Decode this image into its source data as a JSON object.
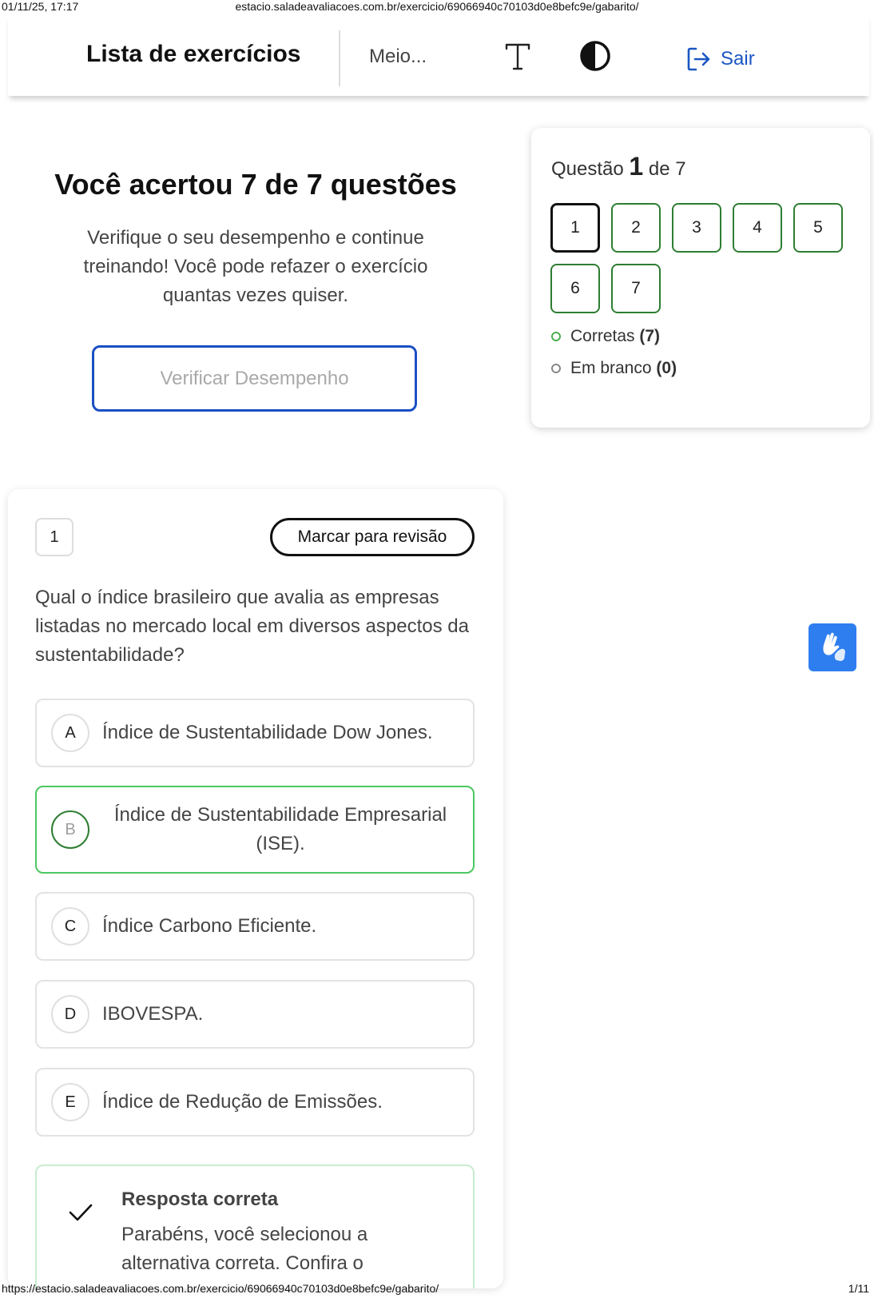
{
  "print_header": {
    "datetime": "01/11/25, 17:17",
    "url": "estacio.saladeavaliacoes.com.br/exercicio/69066940c70103d0e8befc9e/gabarito/"
  },
  "print_footer": {
    "url": "https://estacio.saladeavaliacoes.com.br/exercicio/69066940c70103d0e8befc9e/gabarito/",
    "page": "1/11"
  },
  "navbar": {
    "title": "Lista de exercícios",
    "section": "Meio...",
    "font_icon": "font-size-icon",
    "contrast_icon": "contrast-icon",
    "logout_label": "Sair",
    "logout_icon": "logout-icon",
    "accent_color": "#1a56c4"
  },
  "result": {
    "title": "Você acertou 7 de 7 questões",
    "text": "Verifique o seu desempenho e continue treinando! Você pode refazer o exercício quantas vezes quiser.",
    "button_label": "Verificar Desempenho"
  },
  "question_panel": {
    "prefix": "Questão",
    "current": "1",
    "suffix": "de 7",
    "numbers": [
      "1",
      "2",
      "3",
      "4",
      "5",
      "6",
      "7"
    ],
    "legend_correct_label": "Corretas",
    "legend_correct_count": "(7)",
    "legend_blank_label": "Em branco",
    "legend_blank_count": "(0)"
  },
  "question": {
    "number": "1",
    "review_label": "Marcar para revisão",
    "text": "Qual o índice brasileiro que avalia as empresas listadas no mercado local em diversos aspectos da sustentabilidade?",
    "options": [
      {
        "letter": "A",
        "text": "Índice de Sustentabilidade Dow Jones."
      },
      {
        "letter": "B",
        "text": "Índice de Sustentabilidade Empresarial (ISE)."
      },
      {
        "letter": "C",
        "text": "Índice Carbono Eficiente."
      },
      {
        "letter": "D",
        "text": "IBOVESPA."
      },
      {
        "letter": "E",
        "text": "Índice de Redução de Emissões."
      }
    ],
    "correct_letter": "B",
    "correct_color": "#4cc763",
    "feedback_title": "Resposta correta",
    "feedback_text": "Parabéns, você selecionou a alternativa correta. Confira o"
  },
  "accessibility": {
    "libras_icon": "sign-language-icon",
    "color": "#2f7ef0"
  }
}
